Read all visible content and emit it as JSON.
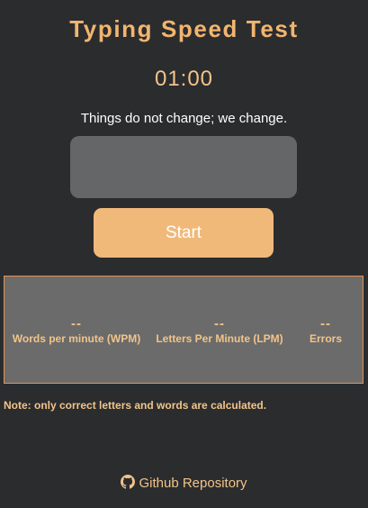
{
  "header": {
    "title": "Typing Speed Test"
  },
  "timer": {
    "display": "01:00"
  },
  "quote": {
    "text": "Things do not change; we change."
  },
  "input": {
    "value": "",
    "placeholder": ""
  },
  "start_button": {
    "label": "Start"
  },
  "stats": {
    "wpm": {
      "value": "--",
      "label": "Words per minute (WPM)"
    },
    "lpm": {
      "value": "--",
      "label": "Letters Per Minute (LPM)"
    },
    "errors": {
      "value": "--",
      "label": "Errors"
    }
  },
  "note": {
    "text": "Note: only correct letters and words are calculated."
  },
  "footer": {
    "link_text": "Github Repository",
    "icon": "github-icon"
  },
  "colors": {
    "background": "#2b2c2e",
    "accent": "#f2b56f",
    "button": "#f0b97a",
    "panel": "#6b6b6b",
    "panel_border": "#e89150",
    "input_bg": "#656667"
  }
}
